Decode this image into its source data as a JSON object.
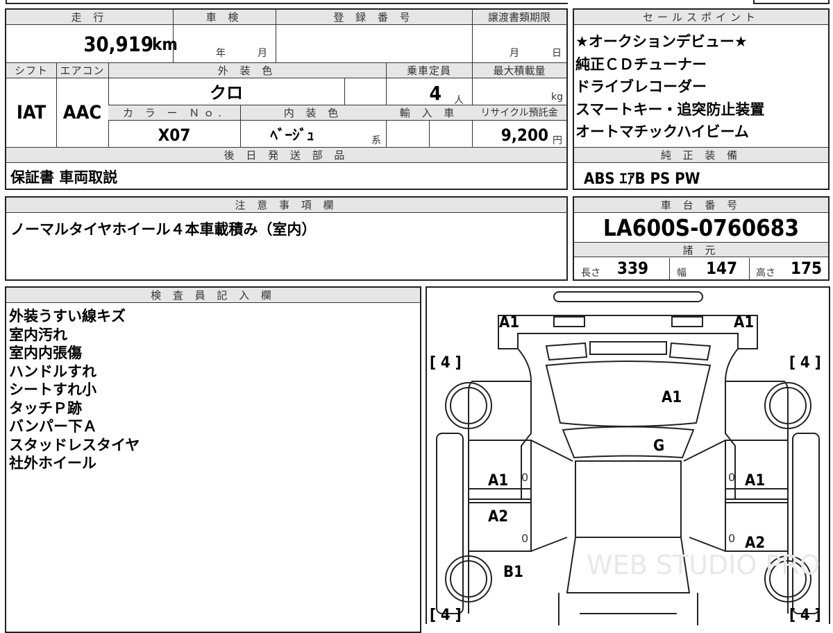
{
  "vehicle": {
    "mileage_header": "走 行",
    "inspection_header": "車 検",
    "registration_header": "登 録 番 号",
    "transfer_header": "譲渡書類期限",
    "mileage_value": "30,919",
    "mileage_unit": "km",
    "inspection_year_label": "年",
    "inspection_month_label": "月",
    "transfer_month_label": "月",
    "transfer_day_label": "日",
    "shift_header": "シフト",
    "ac_header": "エアコン",
    "exterior_color_header": "外 装 色",
    "capacity_header": "乗車定員",
    "max_load_header": "最大積載量",
    "shift_value": "IAT",
    "ac_value": "AAC",
    "exterior_color_value": "クロ",
    "capacity_value": "4",
    "capacity_unit": "人",
    "max_load_unit": "kg",
    "color_no_header": "カ ラ ー Ｎｏ.",
    "interior_color_header": "内 装 色",
    "import_header": "輸 入 車",
    "recycle_header": "リサイクル預託金",
    "color_no_value": "X07",
    "interior_color_value": "ﾍﾞｰｼﾞｭ",
    "interior_color_suffix": "系",
    "recycle_value": "9,200",
    "recycle_unit": "円"
  },
  "later_parts": {
    "header": "後 日 発 送 部 品",
    "value": "保証書 車両取説"
  },
  "sales_points": {
    "header": "セールスポイント",
    "items": [
      "★オークションデビュー★",
      "純正ＣＤチューナー",
      "ドライブレコーダー",
      "スマートキー・追突防止装置",
      "オートマチックハイビーム"
    ]
  },
  "equipment": {
    "header": "純 正 装 備",
    "value": "ABS ｴｱB PS PW"
  },
  "notes": {
    "header": "注 意 事 項 欄",
    "value": "ノーマルタイヤホイール４本車載積み（室内）"
  },
  "chassis": {
    "header": "車 台 番 号",
    "value": "LA600S-0760683",
    "spec_header": "諸 元",
    "length_label": "長さ",
    "length_value": "339",
    "width_label": "幅",
    "width_value": "147",
    "height_label": "高さ",
    "height_value": "175"
  },
  "inspector": {
    "header": "検 査 員 記 入 欄",
    "lines": [
      "外装うすい線キズ",
      "室内汚れ",
      "室内内張傷",
      "ハンドルすれ",
      "シートすれ小",
      "タッチＰ跡",
      "バンパー下Ａ",
      "スタッドレスタイヤ",
      "社外ホイール"
    ]
  },
  "diagram": {
    "tire_tl": "[ 4 ]",
    "tire_tr": "[ 4 ]",
    "tire_bl": "[ 4 ]",
    "tire_br": "[ 4 ]",
    "front_left": "A1",
    "front_right": "A1",
    "hood": "A1",
    "windshield": "G",
    "left_front_door": "A1",
    "left_front_door_num": "0",
    "right_front_door": "A1",
    "right_front_door_num": "0",
    "left_rear_door": "A2",
    "left_rear_door_num": "0",
    "right_rear_door": "A2",
    "right_rear_door_num": "0",
    "left_rear_quarter": "B1",
    "watermark": "WEB STUDIO PRO"
  }
}
